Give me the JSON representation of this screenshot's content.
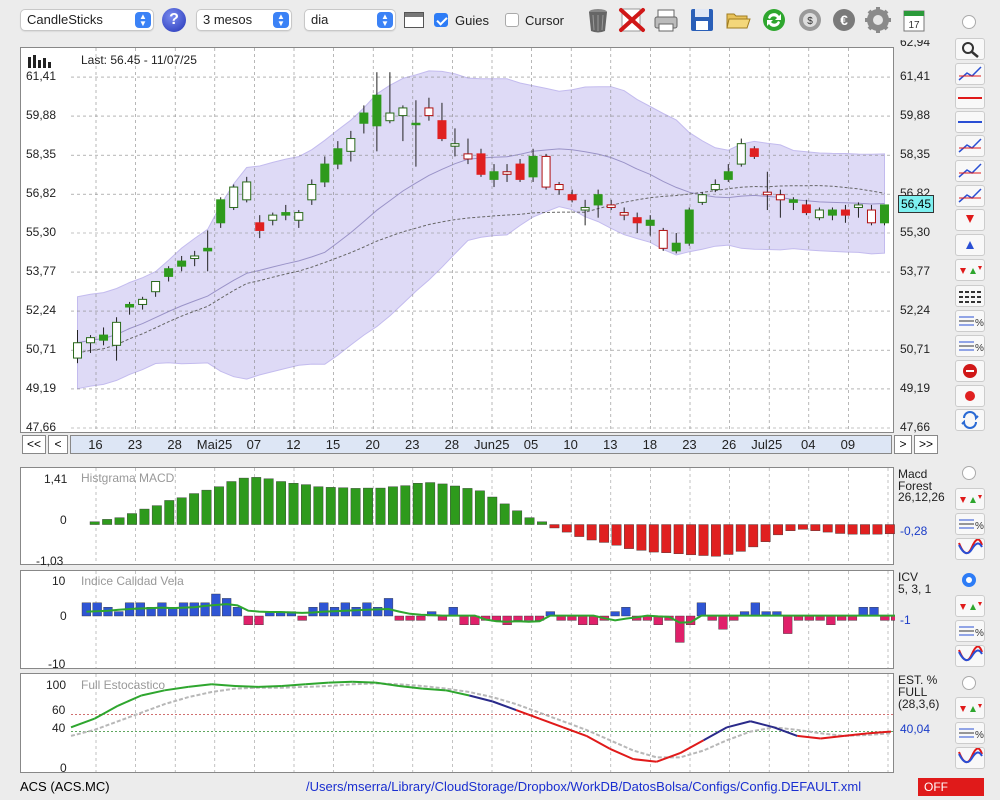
{
  "toolbar": {
    "chart_type": "CandleSticks",
    "period": "3 mesos",
    "interval": "dia",
    "guides_label": "Guies",
    "guides_checked": true,
    "cursor_label": "Cursor",
    "cursor_checked": false
  },
  "main": {
    "last_label": "Last: 56.45 - 11/07/25",
    "current_price": "56,45",
    "y_ticks": [
      "61,41",
      "59,88",
      "58,35",
      "56,82",
      "55,30",
      "53,77",
      "52,24",
      "50,71",
      "49,19",
      "47,66"
    ],
    "y_top_partial": "62,94",
    "x_ticks": [
      "16",
      "23",
      "28",
      "Mai25",
      "07",
      "12",
      "15",
      "20",
      "23",
      "28",
      "Jun25",
      "05",
      "10",
      "13",
      "18",
      "23",
      "26",
      "Jul25",
      "04",
      "09"
    ],
    "nav": {
      "first": "<<",
      "prev": "<",
      "next": ">",
      "last": ">>"
    }
  },
  "macd": {
    "title": "Histgrama MACD",
    "y_ticks": [
      "1,41",
      "0",
      "-1,03"
    ],
    "legend_1": "Macd",
    "legend_2": "Forest",
    "legend_3": "26,12,26",
    "value": "-0,28"
  },
  "icv": {
    "title": "Indice Calidad Vela",
    "y_ticks": [
      "10",
      "0",
      "-10"
    ],
    "legend_1": "ICV",
    "legend_2": "5, 3, 1",
    "value": "-1"
  },
  "stoch": {
    "title": "Full Estocastico",
    "y_ticks": [
      "100",
      "60",
      "40",
      "0"
    ],
    "legend_1": "EST. %",
    "legend_2": "FULL",
    "legend_3": "(28,3,6)",
    "value": "40,04"
  },
  "status": {
    "ticker": "ACS (ACS.MC)",
    "path": "/Users/mserra/Library/CloudStorage/Dropbox/WorkDB/DatosBolsa/Configs/Config.DEFAULT.xml",
    "mode": "OFF"
  },
  "colors": {
    "up": "#2e9a1c",
    "down": "#e02020",
    "band": "#d9d4f5",
    "accent": "#2d7cf6",
    "value_text": "#1a3cc8"
  },
  "chart_data": [
    {
      "type": "candlestick",
      "title": "",
      "ylim": [
        47.66,
        62.94
      ],
      "candles": [
        [
          50.4,
          51.5,
          50.2,
          51.0
        ],
        [
          51.0,
          51.3,
          50.6,
          51.2
        ],
        [
          51.1,
          51.6,
          50.9,
          51.3
        ],
        [
          50.9,
          52.0,
          50.3,
          51.8
        ],
        [
          52.4,
          52.6,
          52.1,
          52.5
        ],
        [
          52.5,
          52.8,
          52.3,
          52.7
        ],
        [
          53.0,
          53.4,
          52.8,
          53.4
        ],
        [
          53.6,
          54.0,
          53.4,
          53.9
        ],
        [
          54.0,
          54.4,
          53.8,
          54.2
        ],
        [
          54.3,
          54.6,
          54.0,
          54.4
        ],
        [
          54.6,
          55.4,
          53.8,
          54.7
        ],
        [
          55.7,
          56.7,
          55.5,
          56.6
        ],
        [
          56.3,
          57.2,
          56.2,
          57.1
        ],
        [
          56.6,
          57.5,
          56.5,
          57.3
        ],
        [
          55.7,
          56.0,
          55.1,
          55.4
        ],
        [
          55.8,
          56.1,
          55.6,
          56.0
        ],
        [
          56.0,
          56.4,
          55.8,
          56.1
        ],
        [
          55.8,
          56.2,
          55.5,
          56.1
        ],
        [
          56.6,
          57.4,
          56.4,
          57.2
        ],
        [
          57.3,
          58.3,
          57.1,
          58.0
        ],
        [
          58.0,
          58.9,
          57.8,
          58.6
        ],
        [
          58.5,
          59.3,
          58.1,
          59.0
        ],
        [
          59.6,
          60.3,
          59.2,
          60.0
        ],
        [
          59.5,
          61.6,
          58.5,
          60.7
        ],
        [
          59.7,
          61.6,
          59.6,
          60.0
        ],
        [
          59.9,
          60.3,
          58.9,
          60.2
        ],
        [
          59.6,
          60.5,
          57.9,
          59.6
        ],
        [
          60.2,
          60.6,
          59.7,
          59.9
        ],
        [
          59.7,
          60.4,
          58.9,
          59.0
        ],
        [
          58.7,
          59.4,
          58.3,
          58.8
        ],
        [
          58.4,
          59.0,
          58.0,
          58.2
        ],
        [
          58.4,
          58.6,
          57.5,
          57.6
        ],
        [
          57.4,
          58.0,
          57.1,
          57.7
        ],
        [
          57.7,
          58.0,
          57.3,
          57.6
        ],
        [
          58.0,
          58.2,
          57.3,
          57.4
        ],
        [
          57.5,
          58.6,
          57.3,
          58.3
        ],
        [
          58.3,
          58.4,
          57.0,
          57.1
        ],
        [
          57.2,
          57.3,
          56.8,
          57.0
        ],
        [
          56.8,
          57.0,
          56.5,
          56.6
        ],
        [
          56.2,
          56.6,
          55.6,
          56.3
        ],
        [
          56.4,
          57.0,
          55.9,
          56.8
        ],
        [
          56.4,
          56.6,
          56.2,
          56.3
        ],
        [
          56.1,
          56.3,
          55.8,
          56.0
        ],
        [
          55.9,
          56.1,
          55.3,
          55.7
        ],
        [
          55.6,
          56.0,
          55.2,
          55.8
        ],
        [
          55.4,
          55.5,
          54.6,
          54.7
        ],
        [
          54.6,
          55.3,
          54.5,
          54.9
        ],
        [
          54.9,
          56.3,
          54.8,
          56.2
        ],
        [
          56.5,
          56.9,
          56.4,
          56.8
        ],
        [
          57.0,
          57.4,
          56.9,
          57.2
        ],
        [
          57.4,
          58.0,
          57.3,
          57.7
        ],
        [
          58.0,
          59.0,
          57.9,
          58.8
        ],
        [
          58.6,
          58.7,
          58.2,
          58.3
        ],
        [
          56.9,
          57.7,
          56.2,
          56.8
        ],
        [
          56.8,
          57.0,
          55.9,
          56.6
        ],
        [
          56.5,
          56.7,
          56.2,
          56.6
        ],
        [
          56.4,
          56.6,
          56.0,
          56.1
        ],
        [
          55.9,
          56.3,
          55.8,
          56.2
        ],
        [
          56.0,
          56.3,
          55.8,
          56.2
        ],
        [
          56.2,
          56.4,
          55.7,
          56.0
        ],
        [
          56.3,
          56.5,
          55.9,
          56.4
        ],
        [
          56.2,
          56.4,
          55.6,
          55.7
        ],
        [
          55.7,
          56.3,
          55.6,
          56.4
        ]
      ],
      "current": 56.45
    },
    {
      "type": "bar",
      "title": "Histgrama MACD",
      "ylim": [
        -1.03,
        1.41
      ],
      "values": [
        0.08,
        0.15,
        0.2,
        0.32,
        0.45,
        0.55,
        0.7,
        0.78,
        0.9,
        1.0,
        1.1,
        1.25,
        1.35,
        1.37,
        1.33,
        1.25,
        1.2,
        1.16,
        1.1,
        1.08,
        1.07,
        1.05,
        1.06,
        1.06,
        1.1,
        1.13,
        1.2,
        1.22,
        1.18,
        1.12,
        1.05,
        0.98,
        0.8,
        0.6,
        0.4,
        0.2,
        0.08,
        -0.1,
        -0.22,
        -0.35,
        -0.45,
        -0.52,
        -0.6,
        -0.7,
        -0.75,
        -0.8,
        -0.82,
        -0.85,
        -0.88,
        -0.9,
        -0.92,
        -0.87,
        -0.78,
        -0.65,
        -0.5,
        -0.3,
        -0.18,
        -0.14,
        -0.18,
        -0.22,
        -0.26,
        -0.28,
        -0.28,
        -0.28,
        -0.27,
        -0.28
      ]
    },
    {
      "type": "bar",
      "title": "Indice Calidad Vela",
      "ylim": [
        -10,
        10
      ],
      "values": [
        3,
        3,
        2,
        1,
        3,
        3,
        2,
        3,
        2,
        3,
        3,
        3,
        5,
        4,
        2,
        -2,
        -2,
        1,
        1,
        1,
        -1,
        2,
        3,
        2,
        3,
        2,
        3,
        2,
        4,
        -1,
        -1,
        -1,
        1,
        -1,
        2,
        -2,
        -2,
        -1,
        -1,
        -2,
        -1,
        -1,
        -1,
        1,
        -1,
        -1,
        -2,
        -2,
        -1,
        1,
        2,
        -1,
        -1,
        -2,
        -1,
        -6,
        -2,
        3,
        -1,
        -3,
        -1,
        1,
        3,
        1,
        1,
        -4,
        -1,
        -1,
        -1,
        -2,
        -1,
        -1,
        2,
        2,
        -1,
        -1
      ],
      "line": [
        1,
        1.1,
        1.2,
        1.4,
        1.6,
        1.7,
        1.8,
        1.9,
        1.8,
        1.9,
        2,
        2.3,
        2.5,
        2.7,
        2.4,
        1.2,
        1.0,
        0.9,
        0.9,
        0.8,
        0.7,
        0.8,
        1.0,
        1.1,
        1.2,
        1.3,
        1.4,
        1.5,
        1.6,
        1.0,
        0.5,
        0.3,
        0.2,
        0.1,
        0.1,
        0.1,
        0.1,
        -0.8,
        -1.2,
        -1.3,
        -1.2,
        -1.3,
        -1.2,
        0.1,
        0.1,
        0.1,
        0.1,
        0.1,
        -0.5,
        -1.0,
        -0.6,
        -0.3,
        0.1,
        -0.1,
        -0.2,
        -1.5,
        -1.4,
        0.1,
        0.1,
        0.1,
        0.1,
        0.1,
        0.1,
        0.1,
        0.1,
        0.1,
        0.1,
        0.1,
        0.1,
        0.1,
        0.1,
        0.1,
        0.1,
        0.1,
        0.1,
        0.1
      ]
    },
    {
      "type": "line",
      "title": "Full Estocastico",
      "ylim": [
        0,
        100
      ],
      "series": [
        {
          "values": [
            45,
            55,
            70,
            82,
            88,
            92,
            95,
            93,
            92,
            93,
            95,
            97,
            98,
            97,
            93,
            90,
            88,
            82,
            75,
            65,
            55,
            45,
            35,
            20,
            8,
            5,
            15,
            30,
            45,
            52,
            45,
            35,
            32,
            35,
            38,
            40
          ]
        },
        {
          "values": [
            35,
            42,
            52,
            62,
            72,
            80,
            86,
            90,
            91,
            91,
            92,
            93,
            95,
            96,
            95,
            93,
            90,
            86,
            80,
            72,
            62,
            52,
            42,
            30,
            18,
            10,
            10,
            18,
            30,
            40,
            45,
            42,
            38,
            35,
            36,
            38
          ]
        }
      ]
    }
  ]
}
